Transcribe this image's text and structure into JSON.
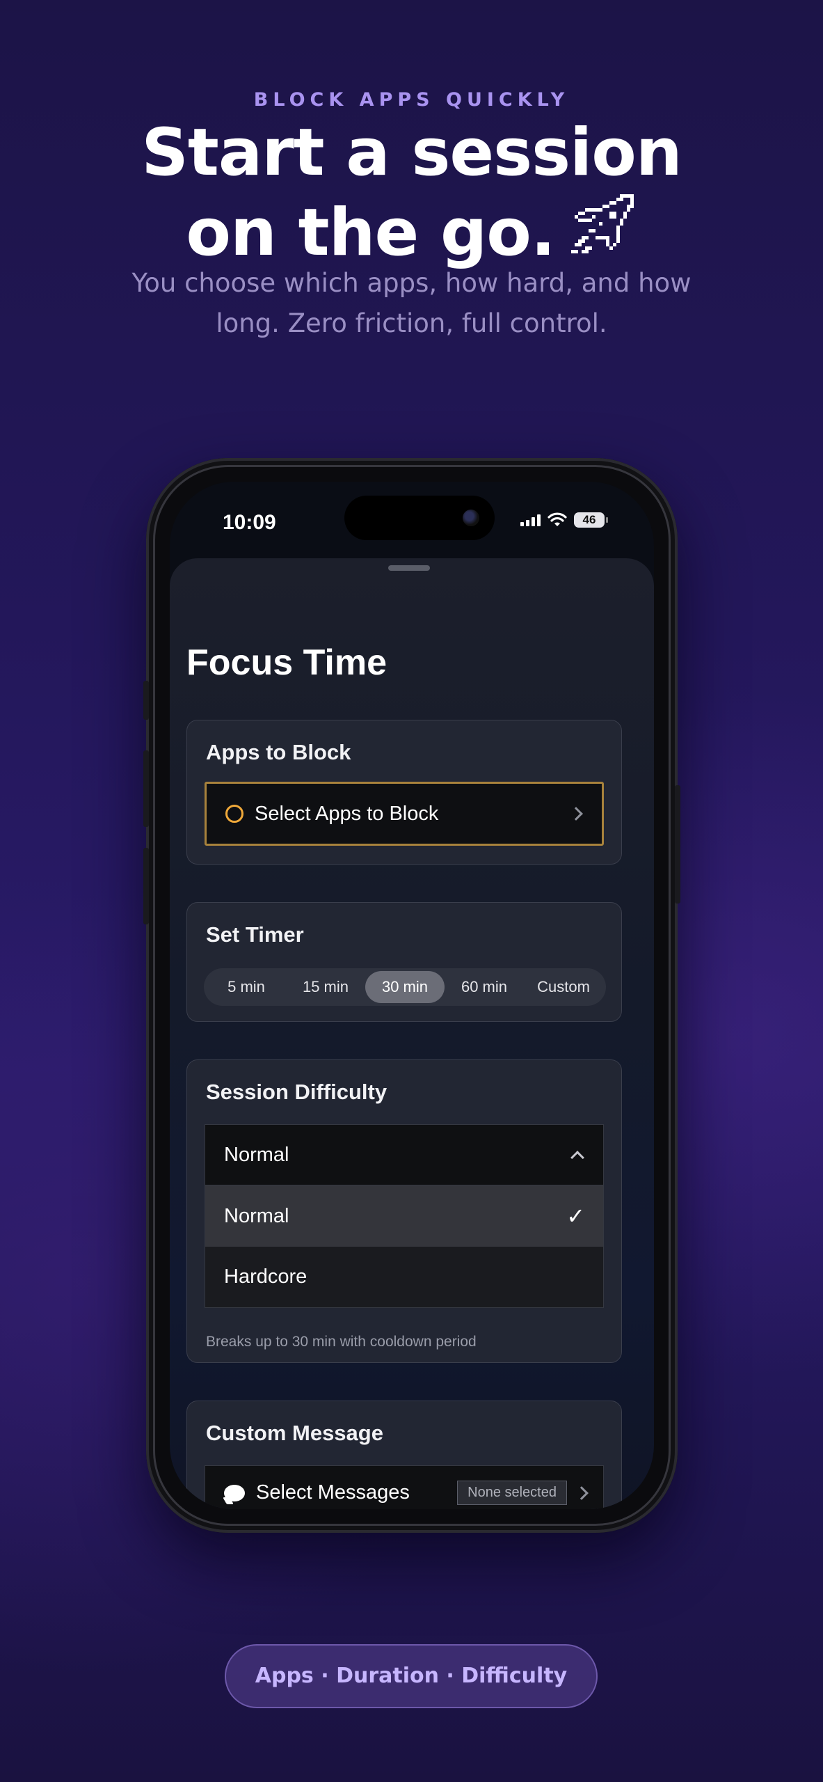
{
  "promo": {
    "eyebrow": "BLOCK APPS QUICKLY",
    "headline_line1": "Start a session",
    "headline_line2": "on the go.",
    "subtitle": "You choose which apps, how hard, and how long. Zero friction, full control.",
    "footer_pill": "Apps · Duration · Difficulty"
  },
  "status_bar": {
    "time": "10:09",
    "battery": "46"
  },
  "sheet": {
    "title": "Focus Time",
    "apps_card": {
      "title": "Apps to Block",
      "select_label": "Select Apps to Block"
    },
    "timer_card": {
      "title": "Set Timer",
      "options": [
        "5 min",
        "15 min",
        "30 min",
        "60 min",
        "Custom"
      ],
      "selected": "30 min"
    },
    "difficulty_card": {
      "title": "Session Difficulty",
      "selected_value": "Normal",
      "options": [
        "Normal",
        "Hardcore"
      ],
      "checkmark": "✓",
      "hint": "Breaks up to 30 min with cooldown period"
    },
    "message_card": {
      "title": "Custom Message",
      "select_label": "Select Messages",
      "badge": "None selected"
    }
  },
  "colors": {
    "accent_orange": "#f0a93a",
    "accent_purple": "#a993f0",
    "background": "#23175a"
  },
  "icons": [
    "rocket-icon",
    "signal-icon",
    "wifi-icon",
    "battery-icon",
    "circle-icon",
    "chevron-right-icon",
    "chevron-up-icon",
    "checkmark-icon",
    "message-bubble-icon"
  ]
}
